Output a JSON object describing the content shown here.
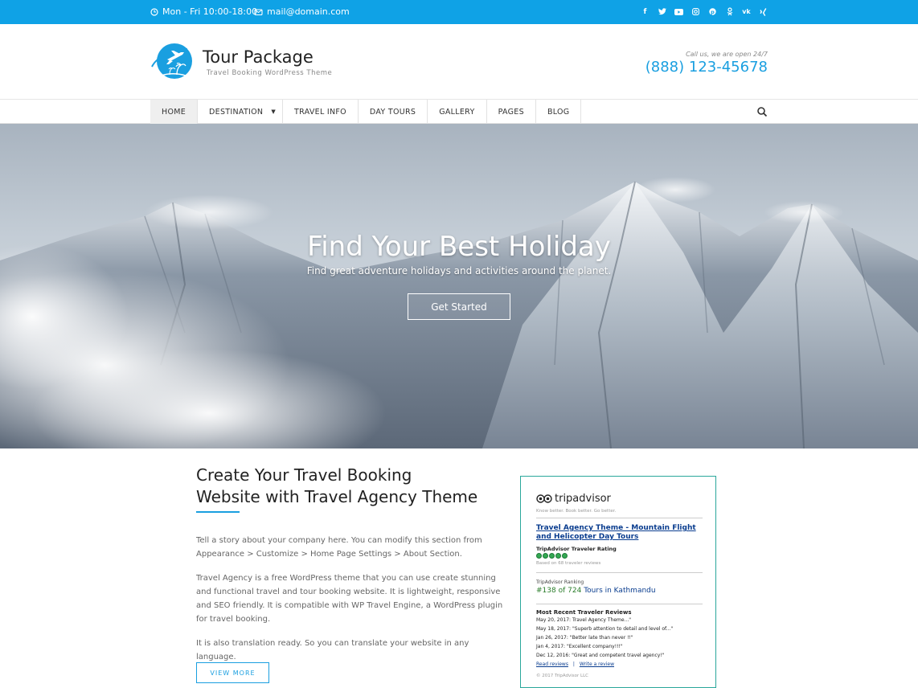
{
  "topbar": {
    "hours": "Mon - Fri 10:00-18:00",
    "email": "mail@domain.com",
    "social_icons": [
      "facebook-icon",
      "twitter-icon",
      "youtube-icon",
      "instagram-icon",
      "pinterest-icon",
      "odnoklassniki-icon",
      "vk-icon",
      "xing-icon"
    ],
    "bg_color": "#0fa2e6"
  },
  "header": {
    "site_title": "Tour Package",
    "tagline": "Travel Booking WordPress Theme",
    "call_label": "Call us, we are open 24/7",
    "phone": "(888) 123-45678",
    "accent_color": "#1a9fe0"
  },
  "nav": {
    "items": [
      {
        "label": "HOME"
      },
      {
        "label": "DESTINATION"
      },
      {
        "label": "TRAVEL INFO"
      },
      {
        "label": "DAY TOURS"
      },
      {
        "label": "GALLERY"
      },
      {
        "label": "PAGES"
      },
      {
        "label": "BLOG"
      }
    ]
  },
  "hero": {
    "title": "Find Your Best Holiday",
    "subtitle": "Find great adventure holidays and activities around the planet.",
    "button": "Get Started"
  },
  "about": {
    "title_line1": "Create Your Travel Booking",
    "title_line2": "Website with Travel Agency Theme",
    "p1": "Tell a story about your company here. You can modify this section from Appearance > Customize > Home Page Settings > About Section.",
    "p2": "Travel Agency is a free WordPress theme that you can use create stunning and functional travel and tour booking website. It is lightweight, responsive and SEO friendly. It is compatible with WP Travel Engine, a WordPress plugin for travel booking.",
    "p3": "It is also translation ready. So you can translate your website in any language.",
    "more_button": "VIEW MORE"
  },
  "tripadvisor": {
    "brand": "tripadvisor",
    "slogan": "Know better. Book better. Go better.",
    "listing": "Travel Agency Theme - Mountain Flight and Helicopter Day Tours",
    "rating_label": "TripAdvisor Traveler Rating",
    "rating": 5,
    "based_on": "Based on 68 traveler reviews",
    "ranking_label": "TripAdvisor Ranking",
    "ranking_hash": "#",
    "ranking_num": "138 of 724",
    "ranking_tail": "Tours in Kathmandu",
    "recent_label": "Most Recent Traveler Reviews",
    "reviews": [
      "May 20, 2017: Travel Agency Theme...\"",
      "May 18, 2017: \"Superb attention to detail and level of...\"",
      "Jan 26, 2017: \"Better late than never !!\"",
      "Jan 4, 2017: \"Excellent company!!!\"",
      "Dec 12, 2016: \"Great and competent travel agency!\""
    ],
    "read_reviews": "Read reviews",
    "sep": "|",
    "write_review": "Write a review",
    "copyright": "© 2017 TripAdvisor LLC",
    "border_color": "#2aa79b"
  }
}
